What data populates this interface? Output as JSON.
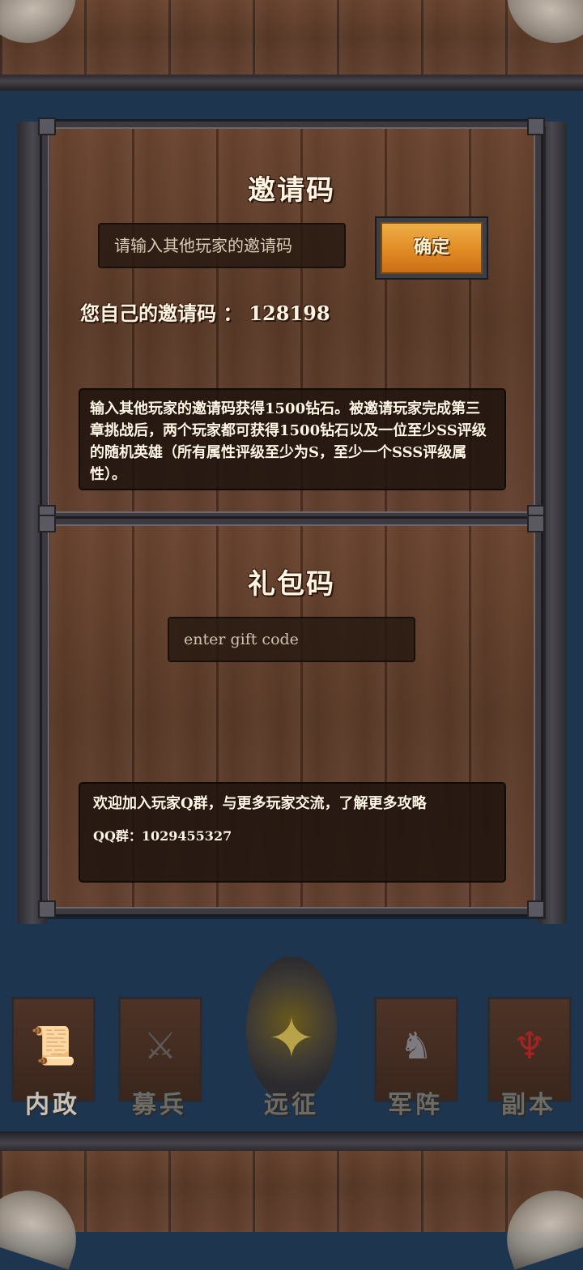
{
  "invite": {
    "title": "邀请码",
    "input_placeholder": "请输入其他玩家的邀请码",
    "confirm_label": "确定",
    "own_code_label": "您自己的邀请码 ：",
    "own_code_value": "128198",
    "description": "输入其他玩家的邀请码获得1500钻石。被邀请玩家完成第三章挑战后，两个玩家都可获得1500钻石以及一位至少SS评级的随机英雄（所有属性评级至少为S，至少一个SSS评级属性）。"
  },
  "gift": {
    "title": "礼包码",
    "input_placeholder": "enter gift code",
    "community_text": "欢迎加入玩家Q群，与更多玩家交流，了解更多攻略",
    "qq_line": "QQ群：1029455327"
  },
  "nav": {
    "items": [
      {
        "label": "内政",
        "icon": "scroll-seal-icon",
        "active": true
      },
      {
        "label": "募兵",
        "icon": "helmets-icon",
        "active": false
      },
      {
        "label": "远征",
        "icon": "sword-emblem-icon",
        "active": false
      },
      {
        "label": "军阵",
        "icon": "chess-knight-icon",
        "active": false
      },
      {
        "label": "副本",
        "icon": "demon-mask-icon",
        "active": false
      }
    ]
  },
  "colors": {
    "background": "#1e3550",
    "button_orange": "#e08a23",
    "text_light": "#fff4e2",
    "nav_inactive": "#6e6a64"
  }
}
